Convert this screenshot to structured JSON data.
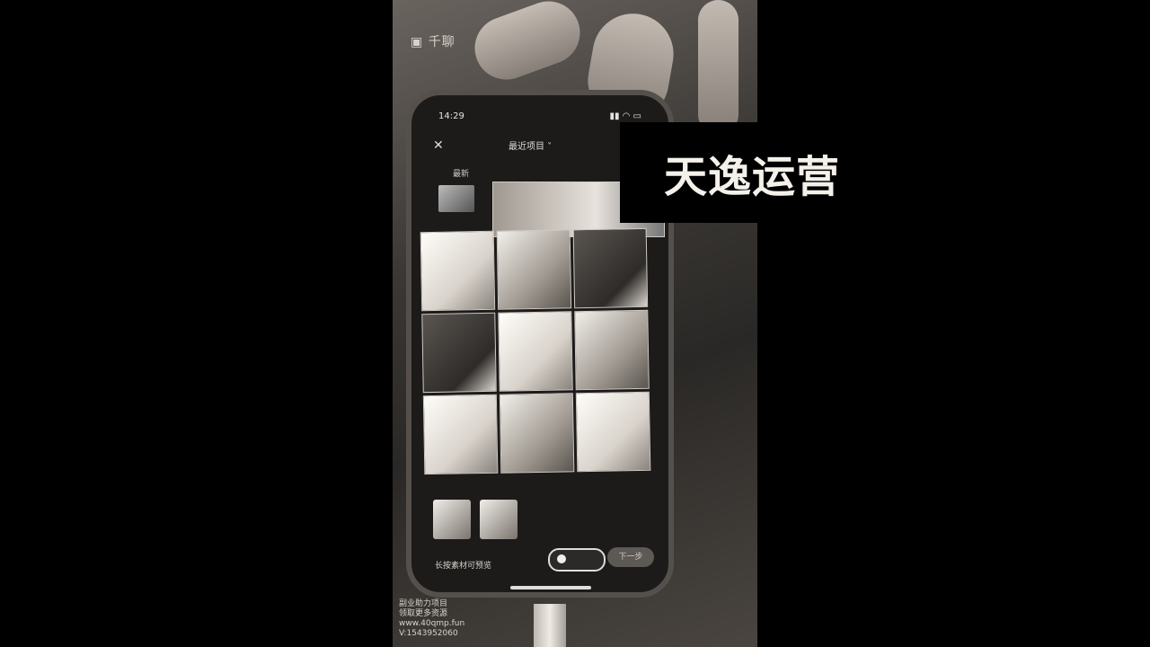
{
  "watermark_top": "千聊",
  "overlay_title": "天逸运营",
  "phone": {
    "status_time": "14:29",
    "status_icons": "▮▮ ◠ ▭",
    "album_title": "最近项目 ˅",
    "recent_label": "最新",
    "hint_text": "长按素材可预览",
    "next_label": "下一步"
  },
  "bottom_watermark": {
    "line1": "副业助力项目",
    "line2": "领取更多资源",
    "line3": "www.40qmp.fun",
    "line4": "V:1543952060"
  }
}
